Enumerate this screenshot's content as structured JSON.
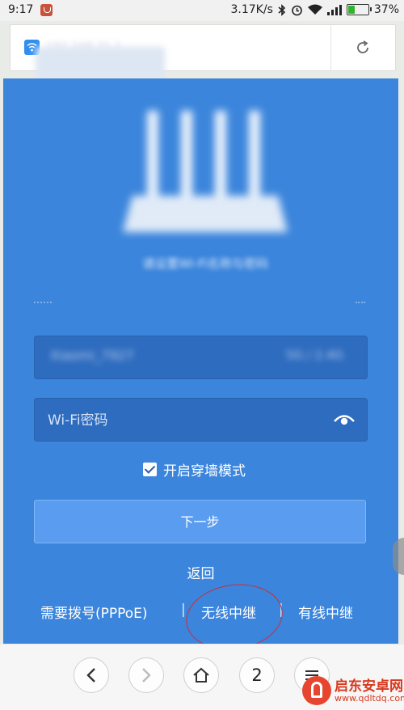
{
  "status_bar": {
    "time": "9:17",
    "network_speed": "3.17K/s",
    "battery_percent": "37%",
    "battery_level": 0.37,
    "icons": [
      "app-notification-icon",
      "bluetooth-icon",
      "alarm-icon",
      "wifi-icon",
      "signal-icon",
      "battery-icon"
    ]
  },
  "address_bar": {
    "url": "192.168.31.1",
    "site_icon": "wifi-icon",
    "reload_icon": "reload-icon"
  },
  "setup": {
    "caption": "请设置Wi-Fi名称与密码",
    "ssid_value": "Xiaomi_7927",
    "ssid_extra": "5G / 2.4G",
    "password_placeholder": "Wi-Fi密码",
    "password_toggle_icon": "eye-icon",
    "wall_mode_label": "开启穿墙模式",
    "wall_mode_checked": true,
    "next_button": "下一步",
    "back_link": "返回",
    "mode_pppoe": "需要拨号(PPPoE)",
    "mode_separator": "|",
    "mode_wireless_relay": "无线中继",
    "mode_wired_relay": "有线中继"
  },
  "browser_toolbar": {
    "tabs_count": "2",
    "icons": [
      "back-arrow-icon",
      "forward-arrow-icon",
      "home-icon",
      "menu-icon"
    ]
  },
  "watermark": {
    "title": "启东安卓网",
    "url": "www.qdltdq.com"
  },
  "colors": {
    "page_blue": "#3b85dc",
    "field_blue": "#2e6cbf",
    "button_blue": "#5a9df0",
    "highlight_red": "#c8303a"
  }
}
